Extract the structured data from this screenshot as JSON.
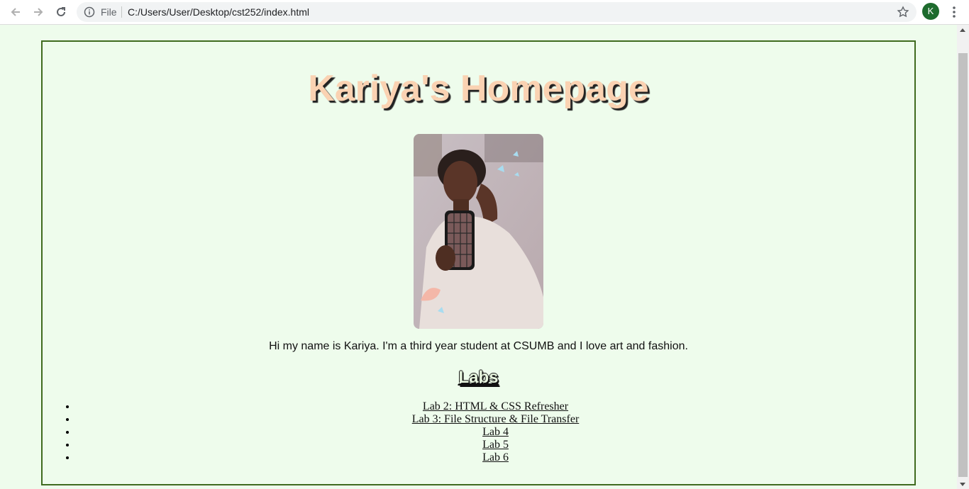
{
  "browser": {
    "file_label": "File",
    "url": "C:/Users/User/Desktop/cst252/index.html",
    "avatar_letter": "K",
    "avatar_color": "#1e6b2e"
  },
  "page": {
    "title": "Kariya's Homepage",
    "bio": "Hi my name is Kariya. I'm a third year student at CSUMB and I love art and fashion.",
    "labs_heading": "Labs",
    "labs": [
      {
        "label": "Lab 2: HTML & CSS Refresher"
      },
      {
        "label": "Lab 3: File Structure & File Transfer"
      },
      {
        "label": "Lab 4"
      },
      {
        "label": "Lab 5"
      },
      {
        "label": "Lab 6"
      }
    ],
    "colors": {
      "background": "#eefcec",
      "frame_border": "#3f6b1f",
      "title": "#fad2b2"
    }
  }
}
